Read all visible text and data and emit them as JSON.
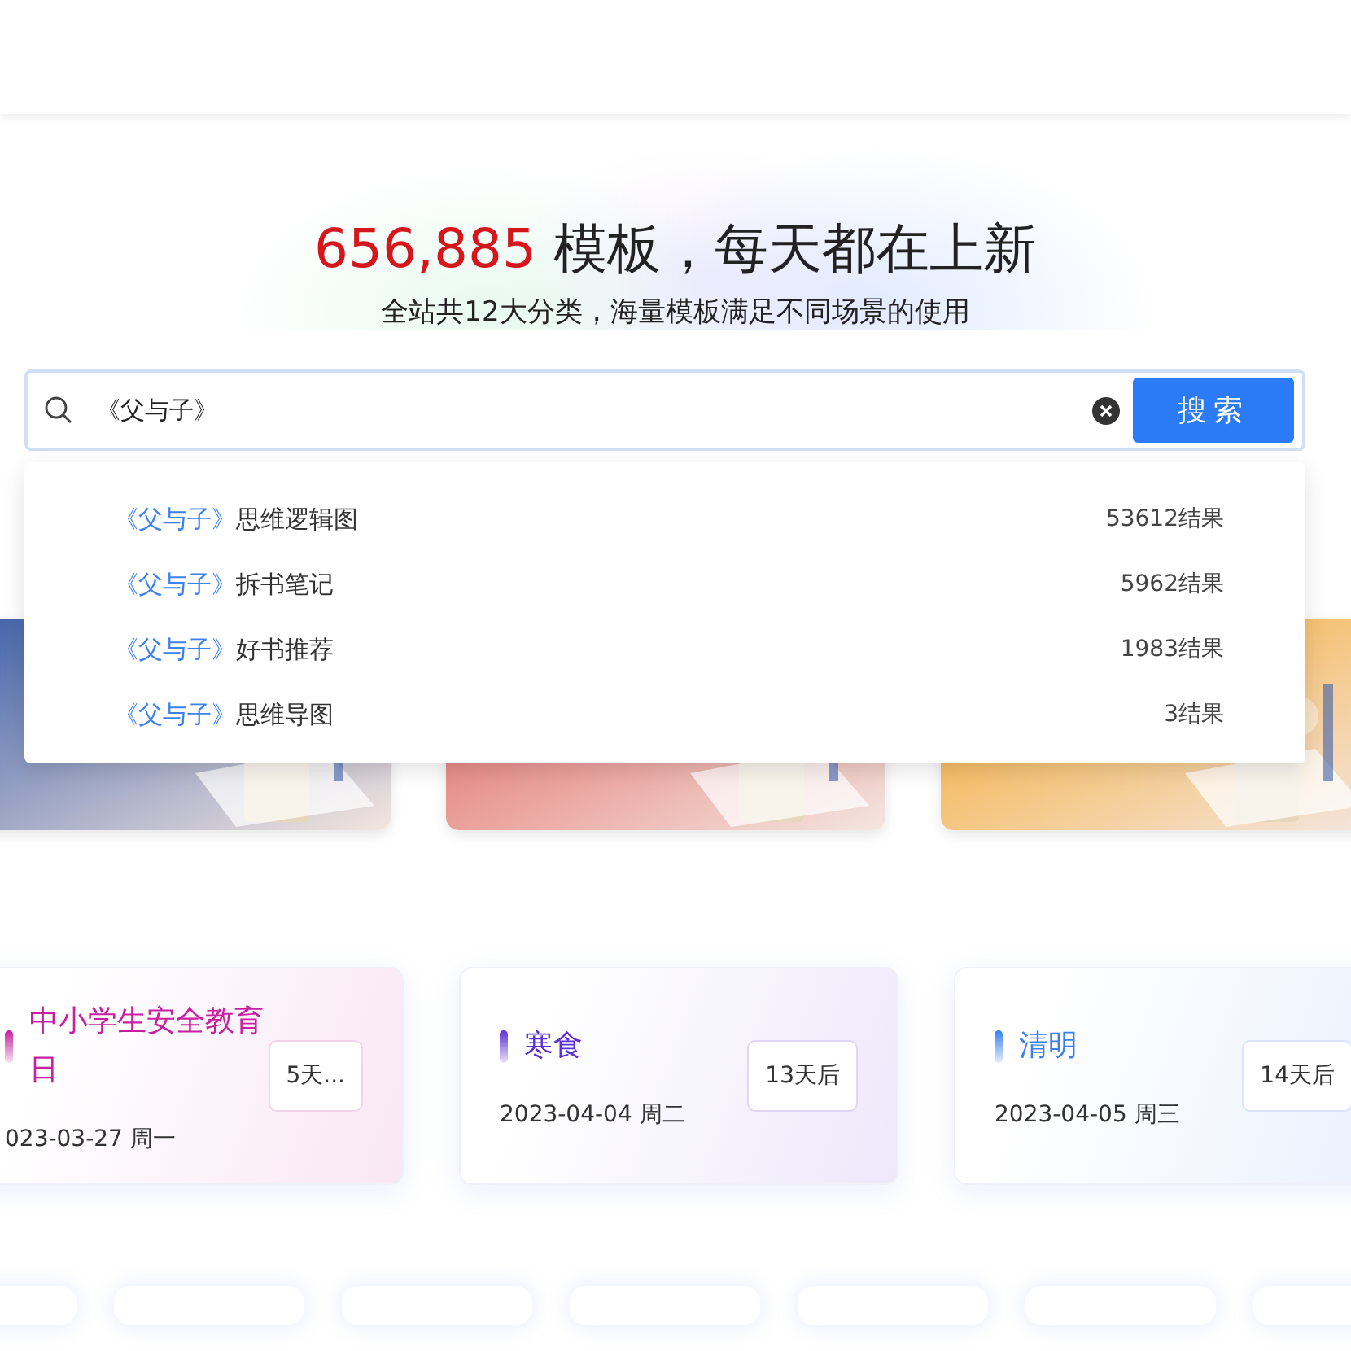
{
  "hero": {
    "count": "656,885",
    "title": "模板，每天都在上新",
    "subtitle": "全站共12大分类，海量模板满足不同场景的使用"
  },
  "search": {
    "value": "《父与子》",
    "button": "搜索"
  },
  "suggestions": [
    {
      "keyword": "《父与子》",
      "suffix": "思维逻辑图",
      "count": "53612结果"
    },
    {
      "keyword": "《父与子》",
      "suffix": "拆书笔记",
      "count": "5962结果"
    },
    {
      "keyword": "《父与子》",
      "suffix": "好书推荐",
      "count": "1983结果"
    },
    {
      "keyword": "《父与子》",
      "suffix": "思维导图",
      "count": "3结果"
    }
  ],
  "events": [
    {
      "title": "中小学生安全教育日",
      "date": "023-03-27 周一",
      "badge": "5天...",
      "color": "#c81fa0"
    },
    {
      "title": "寒食",
      "date": "2023-04-04 周二",
      "badge": "13天后",
      "color": "#5b2fd6"
    },
    {
      "title": "清明",
      "date": "2023-04-05 周三",
      "badge": "14天后",
      "color": "#3a7ff0"
    }
  ]
}
